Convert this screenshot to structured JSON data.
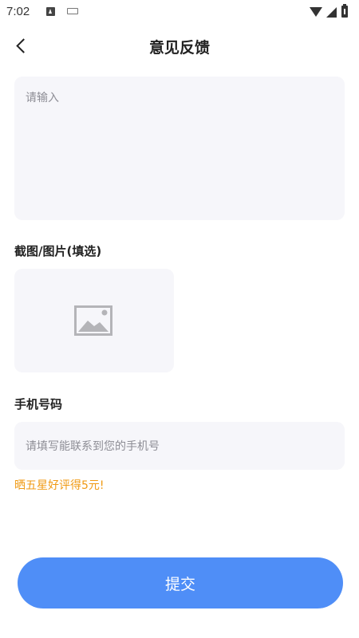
{
  "status_bar": {
    "time": "7:02"
  },
  "header": {
    "title": "意见反馈"
  },
  "feedback": {
    "placeholder": "请输入"
  },
  "screenshot_section": {
    "label": "截图/图片(填选)"
  },
  "phone_section": {
    "label": "手机号码",
    "placeholder": "请填写能联系到您的手机号"
  },
  "promo": {
    "text": "晒五星好评得5元!"
  },
  "actions": {
    "submit_label": "提交"
  },
  "colors": {
    "accent": "#4f8ef7",
    "promo": "#f09a14",
    "field_bg": "#f6f6fa"
  },
  "icons": [
    "back-icon",
    "image-placeholder-icon",
    "wifi-icon",
    "signal-icon",
    "battery-icon"
  ]
}
